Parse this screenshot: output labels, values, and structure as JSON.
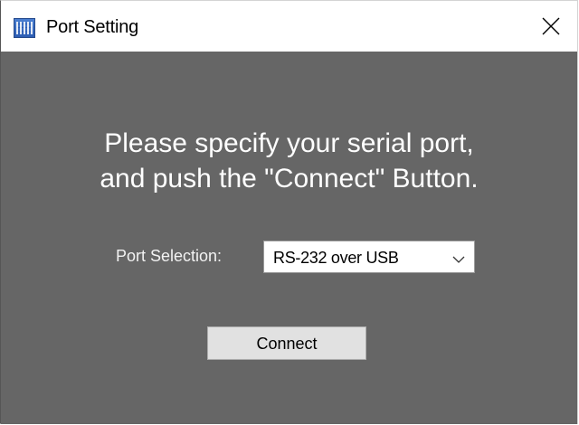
{
  "window": {
    "title": "Port Setting",
    "icon": "app-icon",
    "close_icon": "close-icon"
  },
  "instructions": {
    "line1": "Please specify your serial port,",
    "line2": "and push the \"Connect\" Button."
  },
  "port": {
    "label": "Port Selection:",
    "selected": "RS-232 over USB",
    "chevron_icon": "chevron-down-icon"
  },
  "actions": {
    "connect_label": "Connect"
  },
  "colors": {
    "client_background": "#666666",
    "titlebar_background": "#ffffff",
    "button_background": "#e1e1e1",
    "text_light": "#ffffff"
  }
}
